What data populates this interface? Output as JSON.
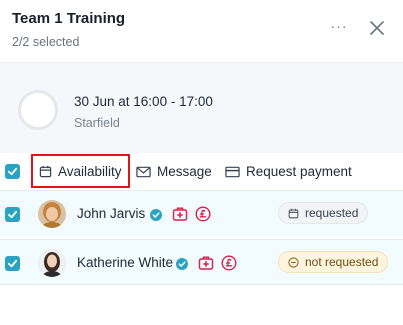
{
  "header": {
    "title": "Team 1 Training",
    "subtitle": "2/2 selected",
    "more_label": "···"
  },
  "event": {
    "time": "30 Jun at 16:00 - 17:00",
    "location": "Starfield"
  },
  "toolbar": {
    "select_all_checked": true,
    "availability_label": "Availability",
    "message_label": "Message",
    "request_payment_label": "Request payment"
  },
  "rows": [
    {
      "name": "John Jarvis",
      "status": "requested",
      "checked": true,
      "verified": true
    },
    {
      "name": "Katherine White",
      "status": "not requested",
      "checked": true,
      "verified": true
    }
  ],
  "colors": {
    "accent": "#2aa3c2",
    "icon_red": "#d6204a",
    "highlight_border": "#e0161d",
    "not_requested_bg": "#fff4dd"
  },
  "icons": [
    "more-icon",
    "close-icon",
    "calendar-icon",
    "envelope-icon",
    "card-icon",
    "verified-icon",
    "first-aid-icon",
    "pound-icon",
    "minus-circle-icon"
  ]
}
